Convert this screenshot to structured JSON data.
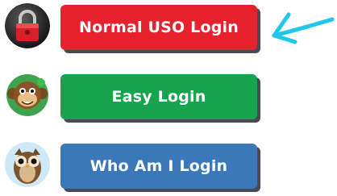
{
  "logins": [
    {
      "label": "Normal USO Login",
      "avatar_icon": "padlock-icon",
      "color": "#e5222e"
    },
    {
      "label": "Easy Login",
      "avatar_icon": "monkey-icon",
      "color": "#17a44e"
    },
    {
      "label": "Who Am I Login",
      "avatar_icon": "owl-icon",
      "color": "#3a78b9"
    }
  ],
  "annotation": {
    "icon": "arrow-left-icon",
    "color": "#1ec8ea"
  }
}
